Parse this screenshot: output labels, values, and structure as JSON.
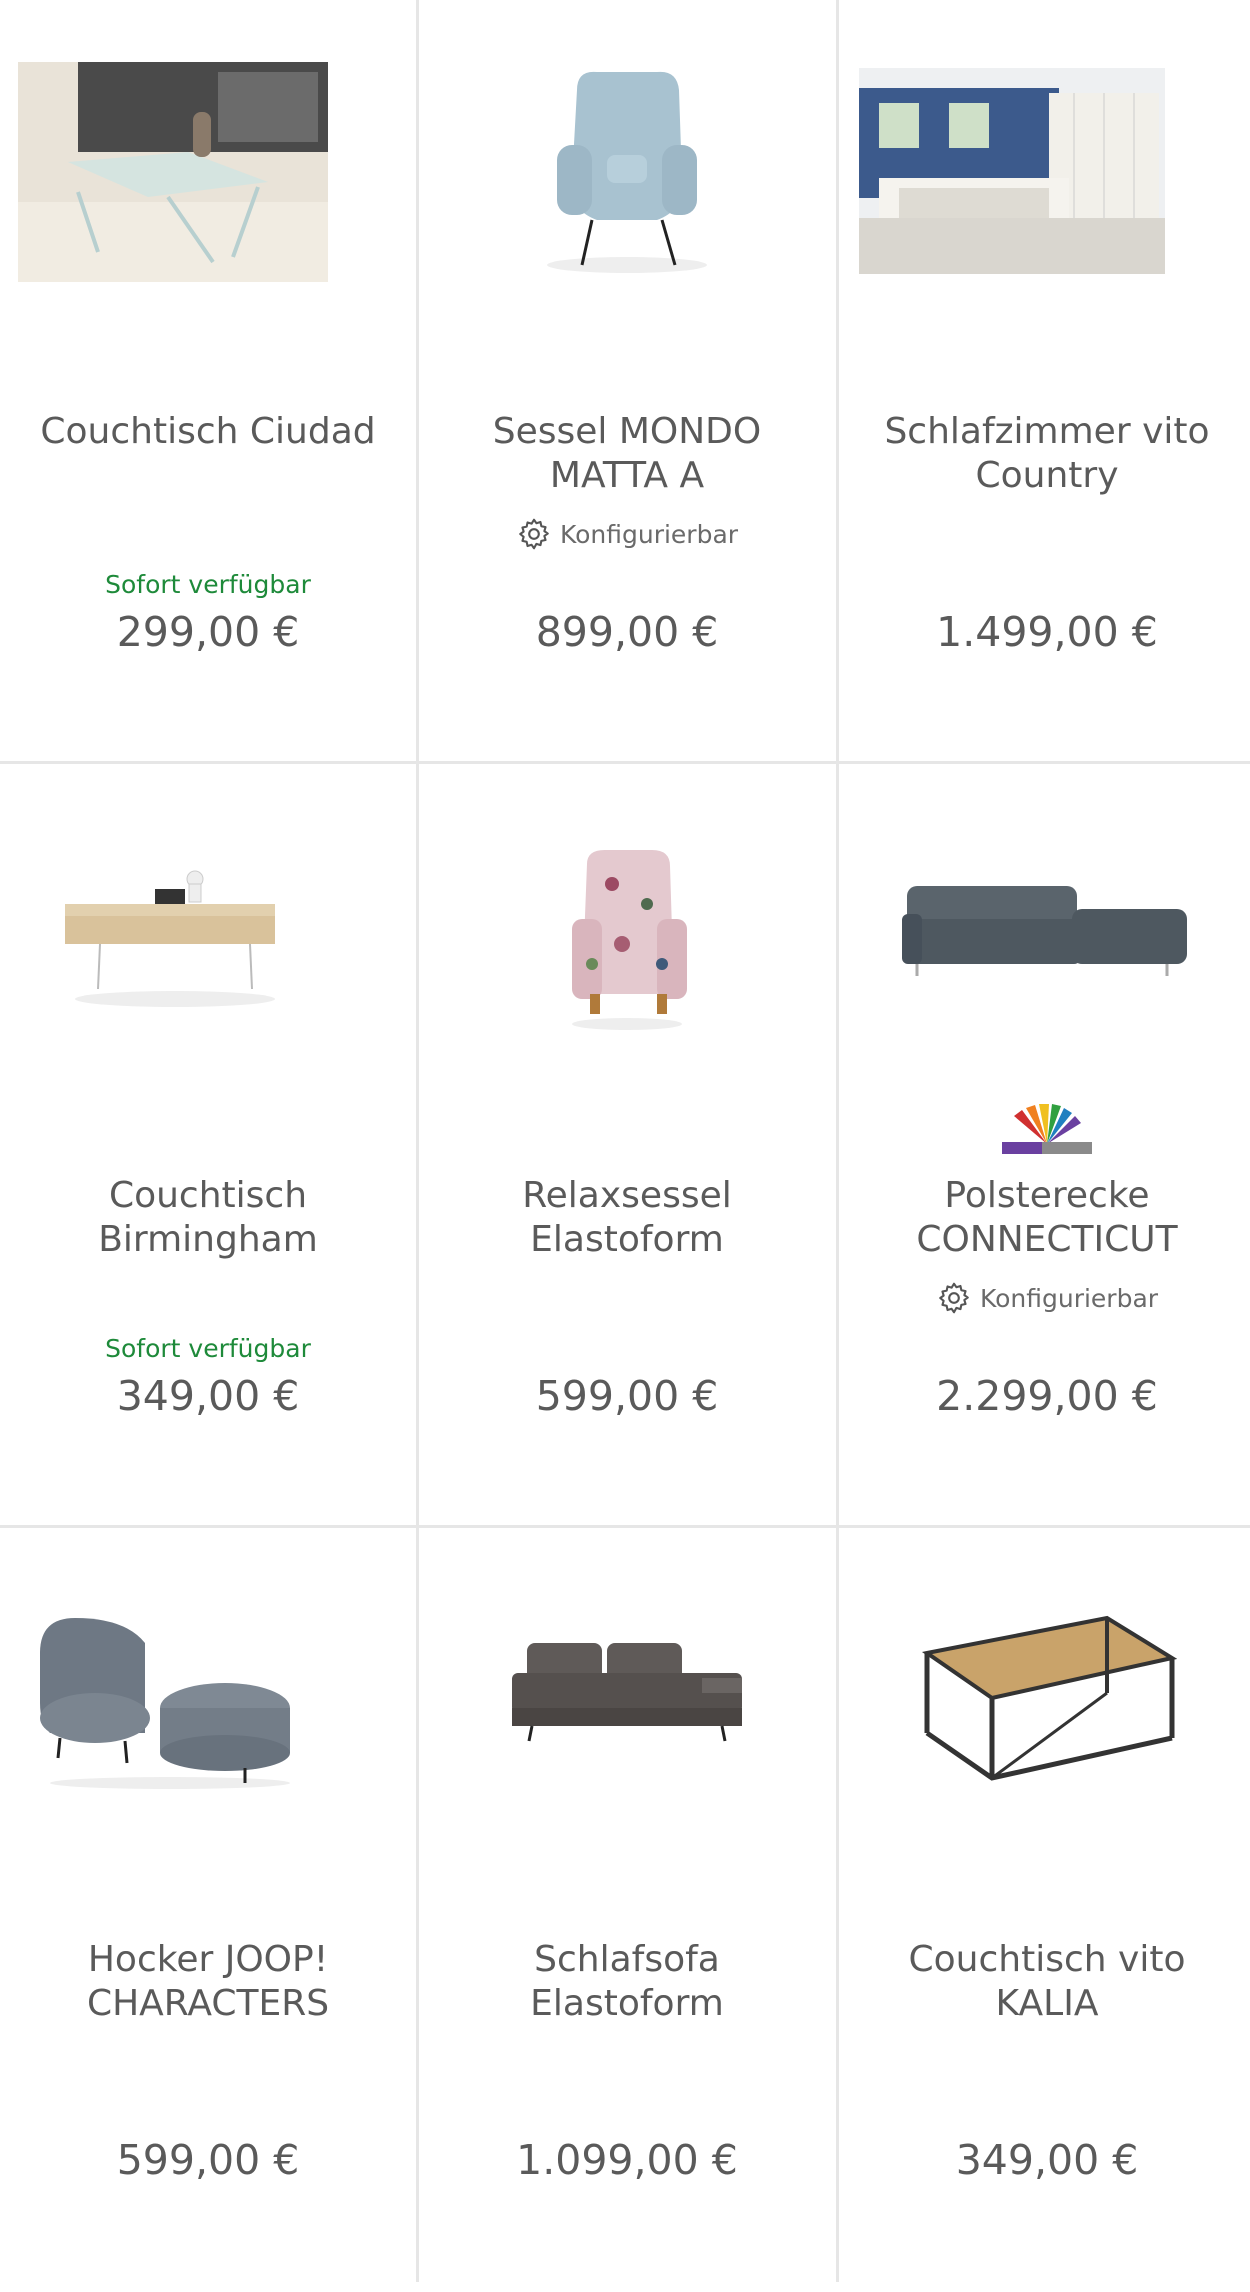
{
  "products": [
    {
      "title": "Couchtisch Ciudad",
      "stock": "Sofort verfügbar",
      "price": "299,00 €",
      "image_icon": "glass-coffee-table-image"
    },
    {
      "title": "Sessel MONDO MATTA A",
      "config": "Konfigurierbar",
      "price": "899,00 €",
      "image_icon": "wingback-armchair-image"
    },
    {
      "title": "Schlafzimmer vito Country",
      "price": "1.499,00 €",
      "image_icon": "bedroom-set-image"
    },
    {
      "title": "Couchtisch Birmingham",
      "stock": "Sofort verfügbar",
      "price": "349,00 €",
      "image_icon": "wooden-coffee-table-image"
    },
    {
      "title": "Relaxsessel Elastoform",
      "price": "599,00 €",
      "image_icon": "floral-armchair-image"
    },
    {
      "title": "Polsterecke CONNECTICUT",
      "config": "Konfigurierbar",
      "price": "2.299,00 €",
      "image_icon": "corner-sofa-image",
      "has_color_swatch": true
    },
    {
      "title": "Hocker JOOP! CHARACTERS",
      "price": "599,00 €",
      "image_icon": "lounge-chair-ottoman-image"
    },
    {
      "title": "Schlafsofa Elastoform",
      "price": "1.099,00 €",
      "image_icon": "sleeper-sofa-image"
    },
    {
      "title": "Couchtisch vito KALIA",
      "price": "349,00 €",
      "image_icon": "metal-frame-table-image"
    }
  ],
  "colors": {
    "stock_green": "#1e8a3a",
    "text_gray": "#5a5a5a",
    "divider": "#e6e6e6"
  }
}
